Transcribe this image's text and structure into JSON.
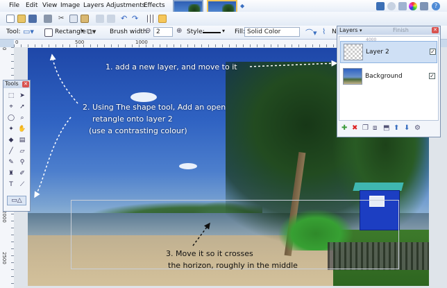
{
  "menu": {
    "items": [
      "File",
      "Edit",
      "View",
      "Image",
      "Layers",
      "Adjustments",
      "Effects"
    ]
  },
  "toolbar": {
    "tool_label": "Tool:",
    "shape_label": "Rectangle",
    "brush_width_label": "Brush width:",
    "brush_width_value": "2",
    "style_label": "Style:",
    "fill_label": "Fill:",
    "fill_value": "Solid Color",
    "extra_label": "N"
  },
  "rulers": {
    "top_marks": [
      "0",
      "500",
      "1000"
    ],
    "left_marks": [
      "0",
      "500",
      "1000",
      "1500",
      "2000",
      "2500"
    ]
  },
  "tools_window": {
    "title": "Tools"
  },
  "layers_window": {
    "title": "Layers",
    "finish_label": "Finish",
    "ruler_mark": "4000",
    "layers": [
      {
        "name": "Layer 2",
        "visible": true,
        "selected": true
      },
      {
        "name": "Background",
        "visible": true,
        "selected": false
      }
    ]
  },
  "annotations": {
    "step1": "1. add a new layer, and move to it",
    "step2_line1": "2. Using The shape tool, Add an open",
    "step2_line2": "retangle onto layer 2",
    "step2_line3": "(use a contrasting colour)",
    "step3_line1": "3. Move it so it crosses",
    "step3_line2": "the horizon, roughly in the middle"
  },
  "colors": {
    "accent": "#2f62c2",
    "annotation_text": "#ffffff",
    "hut_blue": "#1c3ec2"
  }
}
